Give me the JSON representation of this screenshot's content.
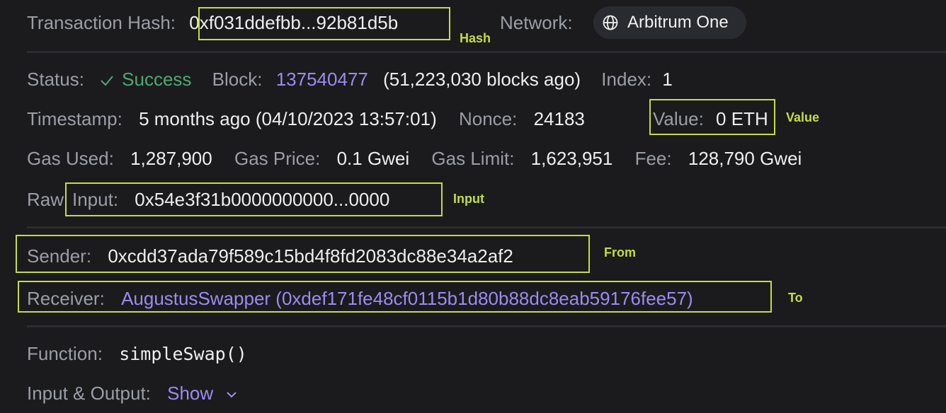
{
  "header": {
    "hash_label": "Transaction Hash:",
    "hash_value": "0xf031ddefbb...92b81d5b",
    "network_label": "Network:",
    "network_value": "Arbitrum One",
    "network_icon": "globe-icon"
  },
  "status_row": {
    "status_label": "Status:",
    "status_value": "Success",
    "status_icon": "check-icon",
    "block_label": "Block:",
    "block_value": "137540477",
    "block_ago": "(51,223,030 blocks ago)",
    "index_label": "Index:",
    "index_value": "1"
  },
  "timestamp_row": {
    "timestamp_label": "Timestamp:",
    "timestamp_value": "5 months ago (04/10/2023 13:57:01)",
    "nonce_label": "Nonce:",
    "nonce_value": "24183",
    "value_label": "Value:",
    "value_value": "0 ETH"
  },
  "gas_row": {
    "gas_used_label": "Gas Used:",
    "gas_used_value": "1,287,900",
    "gas_price_label": "Gas Price:",
    "gas_price_value": "0.1 Gwei",
    "gas_limit_label": "Gas Limit:",
    "gas_limit_value": "1,623,951",
    "fee_label": "Fee:",
    "fee_value": "128,790 Gwei"
  },
  "raw_input_row": {
    "raw_label": "Raw",
    "input_label": "Input:",
    "input_value": "0x54e3f31b0000000000...0000"
  },
  "parties": {
    "sender_label": "Sender:",
    "sender_value": "0xcdd37ada79f589c15bd4f8fd2083dc88e34a2af2",
    "receiver_label": "Receiver:",
    "receiver_value": "AugustusSwapper (0xdef171fe48cf0115b1d80b88dc8eab59176fee57)"
  },
  "function_row": {
    "function_label": "Function:",
    "function_value": "simpleSwap()",
    "io_label": "Input & Output:",
    "io_toggle": "Show",
    "io_icon": "chevron-down-icon"
  },
  "annotations": {
    "hash_tag": "Hash",
    "value_tag": "Value",
    "input_tag": "Input",
    "from_tag": "From",
    "to_tag": "To",
    "highlight_color": "#c4dd3c"
  },
  "colors": {
    "background": "#1b1b1d",
    "label": "#9b9ea6",
    "value": "#eeeeee",
    "link": "#9b8cf0",
    "success": "#4ea874"
  }
}
